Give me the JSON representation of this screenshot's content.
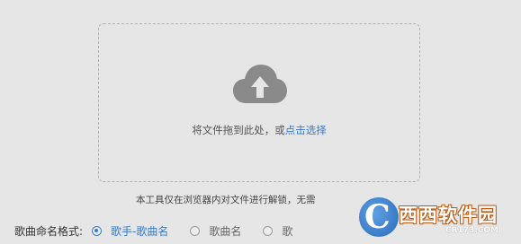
{
  "dropzone": {
    "instruction": "将文件拖到此处，或",
    "link": "点击选择"
  },
  "notice": "本工具仅在浏览器内对文件进行解锁，无需",
  "format": {
    "label": "歌曲命名格式:",
    "options": [
      {
        "label": "歌手-歌曲名",
        "selected": true
      },
      {
        "label": "歌曲名",
        "selected": false
      },
      {
        "label": "歌",
        "selected": false
      }
    ]
  },
  "watermark": {
    "letter": "C",
    "title": "西西软件园",
    "url": "CR173.COM"
  },
  "icons": {
    "upload": "cloud-upload-icon"
  },
  "colors": {
    "accent": "#3a79c8",
    "background": "#e6e6e6"
  }
}
